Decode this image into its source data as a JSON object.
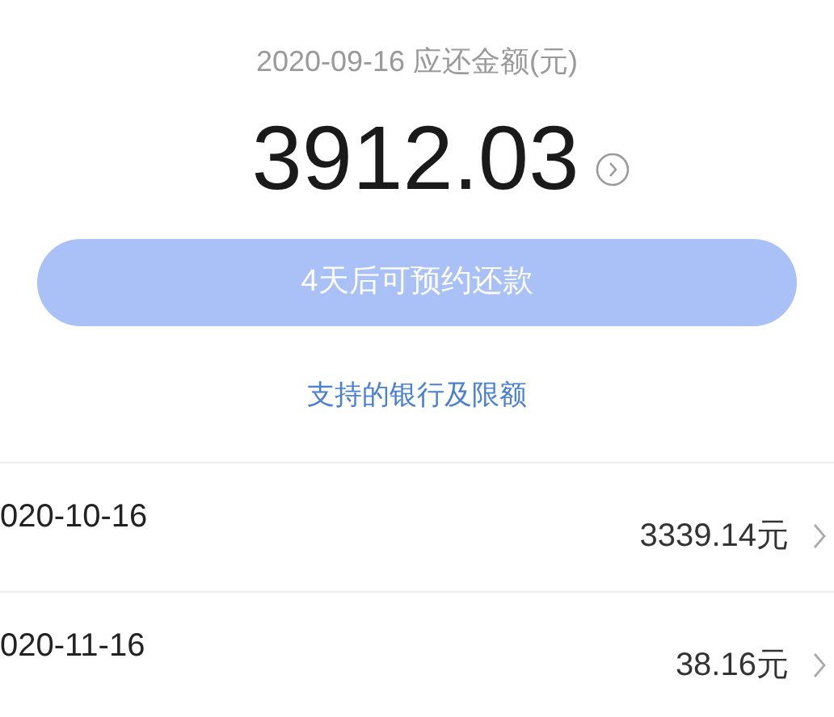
{
  "header": {
    "due_label": "2020-09-16 应还金额(元)",
    "amount": "3912.03"
  },
  "reserve_button": {
    "label": "4天后可预约还款",
    "disabled": true
  },
  "banks_link": "支持的银行及限额",
  "installments": [
    {
      "date": "020-10-16",
      "amount": "3339.14元"
    },
    {
      "date": "020-11-16",
      "amount": "38.16元"
    }
  ]
}
